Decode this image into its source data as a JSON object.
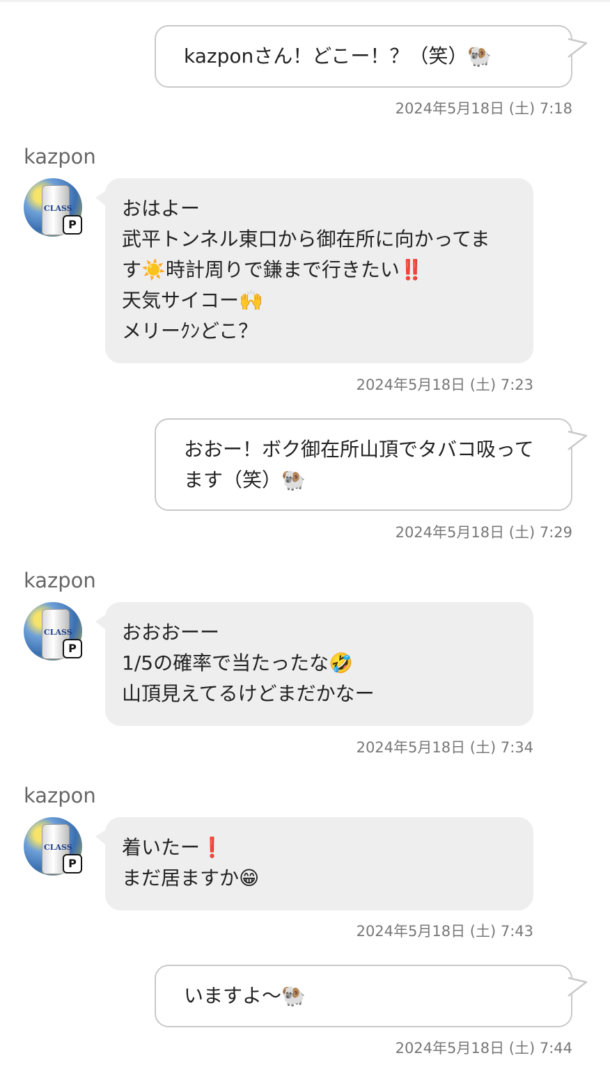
{
  "messages": [
    {
      "type": "out",
      "lines": [
        "kazponさん！どこー！？（笑）🐏"
      ],
      "time": "2024年5月18日 (土) 7:18"
    },
    {
      "type": "in",
      "sender": "kazpon",
      "avatar_label": "CLASS",
      "badge": "P",
      "lines": [
        "おはよー",
        "武平トンネル東口から御在所に向かってま",
        "す☀️時計周りで鎌まで行きたい‼️",
        "天気サイコー🙌",
        "メリーｸﾝどこ？"
      ],
      "time": "2024年5月18日 (土) 7:23"
    },
    {
      "type": "out",
      "lines": [
        "おおー！ボク御在所山頂でタバコ吸って",
        "ます（笑）🐏"
      ],
      "time": "2024年5月18日 (土) 7:29"
    },
    {
      "type": "in",
      "sender": "kazpon",
      "avatar_label": "CLASS",
      "badge": "P",
      "lines": [
        "おおおーー",
        "1/5の確率で当たったな🤣",
        "山頂見えてるけどまだかなー"
      ],
      "time": "2024年5月18日 (土) 7:34"
    },
    {
      "type": "in",
      "sender": "kazpon",
      "avatar_label": "CLASS",
      "badge": "P",
      "lines": [
        "着いたー❗",
        "まだ居ますか😁"
      ],
      "time": "2024年5月18日 (土) 7:43"
    },
    {
      "type": "out",
      "lines": [
        "いますよ〜🐏"
      ],
      "time": "2024年5月18日 (土) 7:44"
    }
  ]
}
